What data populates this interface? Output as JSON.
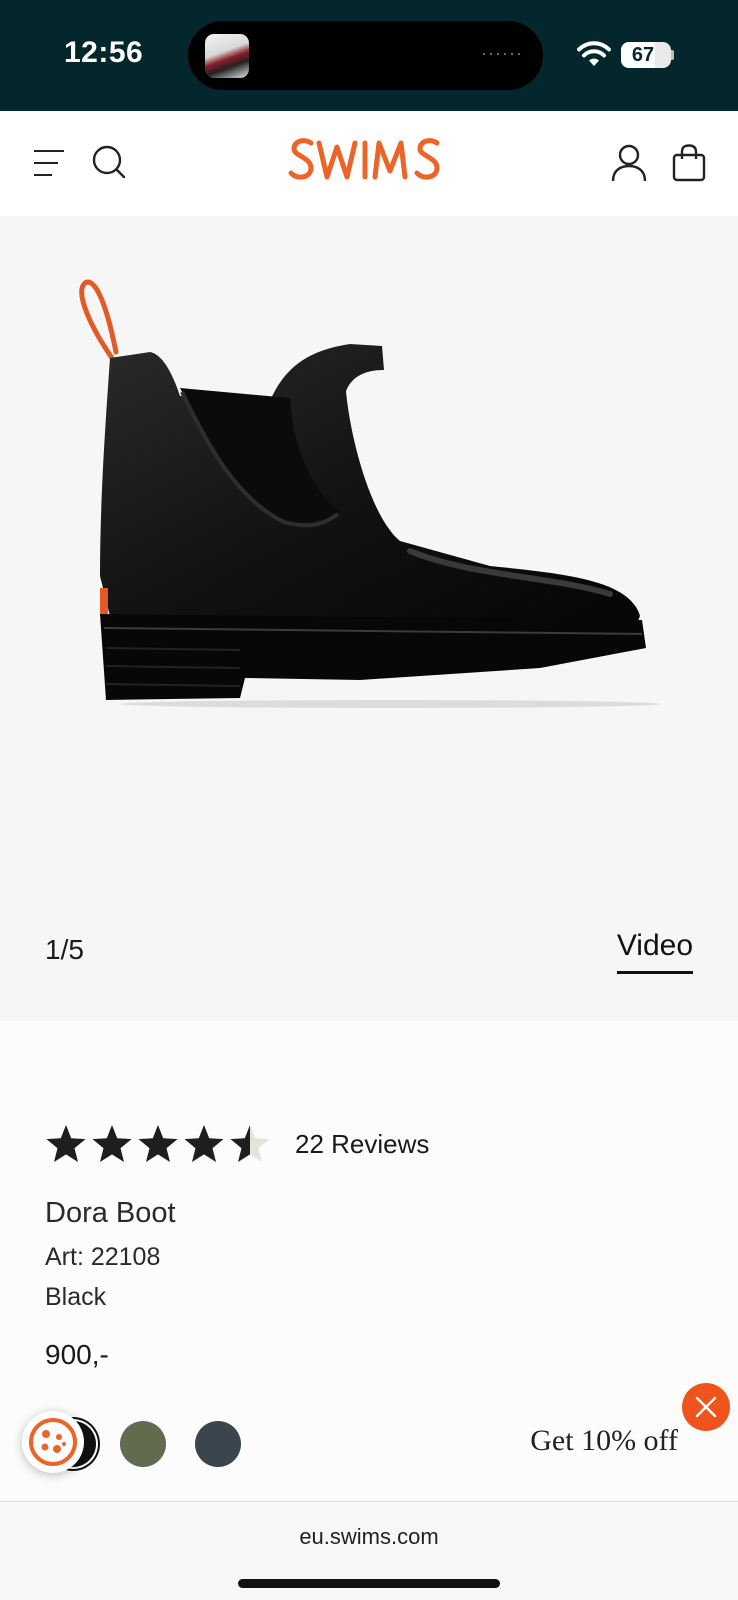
{
  "status_bar": {
    "time": "12:56",
    "battery": "67",
    "battery_level_percent": 67
  },
  "header": {
    "logo_text": "SWIMS",
    "brand_color": "#ec6427",
    "icons": [
      "menu-icon",
      "search-icon",
      "account-icon",
      "shopping-bag-icon"
    ]
  },
  "gallery": {
    "counter": "1/5",
    "video_label": "Video"
  },
  "product": {
    "rating_value": 4.5,
    "reviews_label": "22 Reviews",
    "name": "Dora Boot",
    "art": "Art: 22108",
    "color": "Black",
    "price": "900,-",
    "swatches": [
      {
        "name": "black",
        "color": "#111111",
        "selected": true
      },
      {
        "name": "olive",
        "color": "#616b4d",
        "selected": false
      },
      {
        "name": "slate",
        "color": "#3b454d",
        "selected": false
      }
    ]
  },
  "promo": {
    "text": "Get 10% off",
    "accent_color": "#f0531c"
  },
  "browser": {
    "url": "eu.swims.com"
  }
}
